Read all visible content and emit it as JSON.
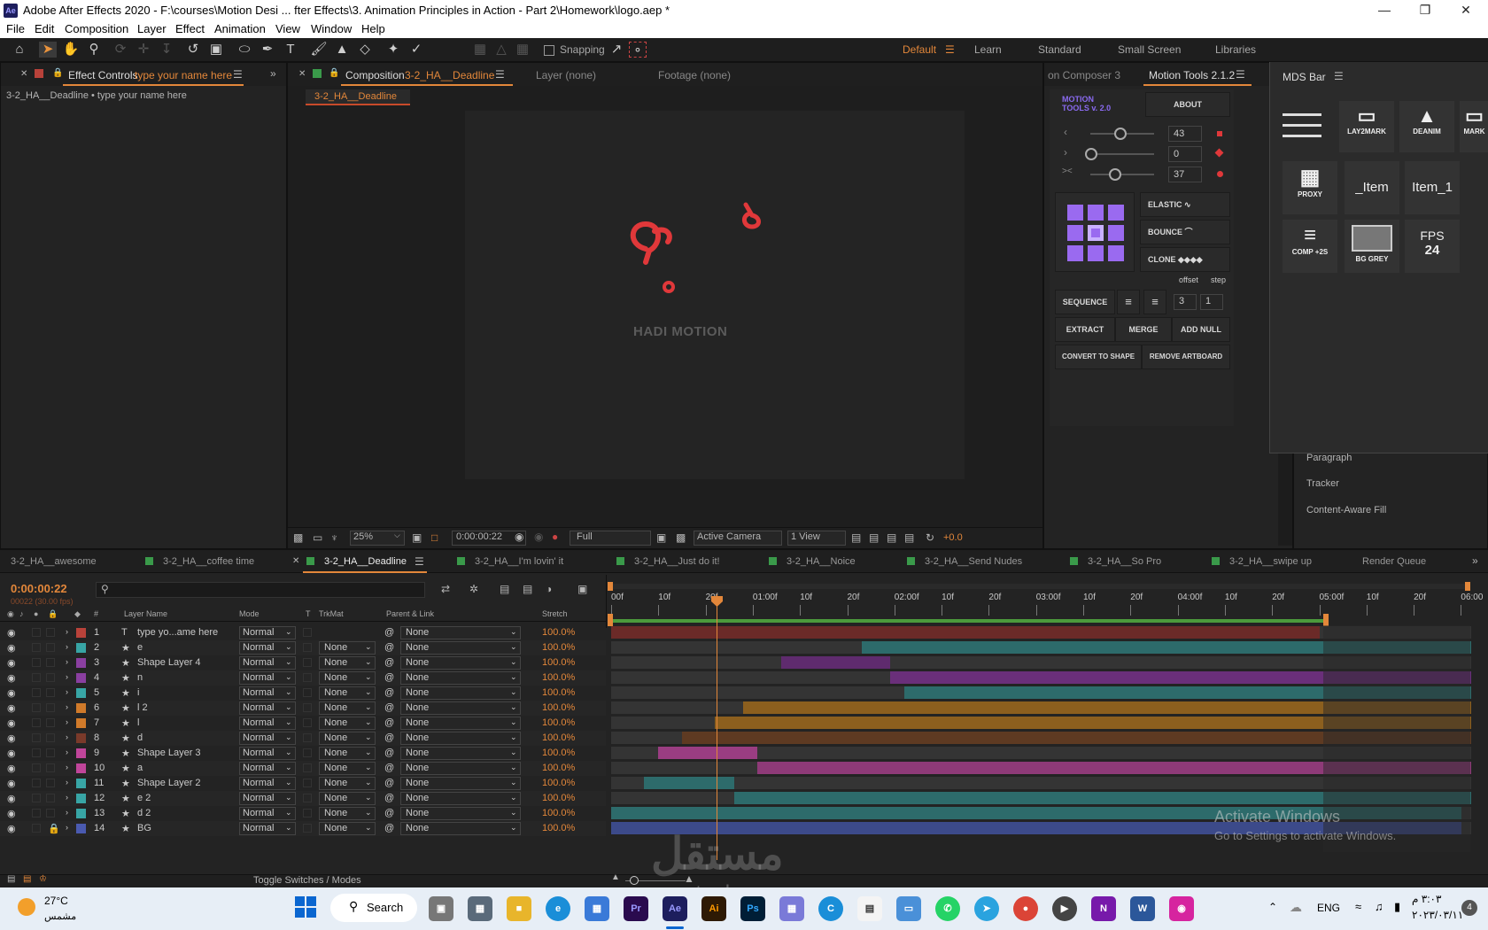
{
  "window": {
    "title": "Adobe After Effects 2020 - F:\\courses\\Motion Desi ... fter Effects\\3. Animation Principles in Action - Part 2\\Homework\\logo.aep *",
    "app_icon": "Ae"
  },
  "menu": [
    "File",
    "Edit",
    "Composition",
    "Layer",
    "Effect",
    "Animation",
    "View",
    "Window",
    "Help"
  ],
  "toolbar": {
    "snapping": "Snapping"
  },
  "workspaces": [
    "Default",
    "Learn",
    "Standard",
    "Small Screen",
    "Libraries"
  ],
  "effect_controls": {
    "tab": "Effect Controls",
    "tab_target": "type your name here",
    "subtitle": "3-2_HA__Deadline • type your name here"
  },
  "composition": {
    "tab": "Composition",
    "tab_name": "3-2_HA__Deadline",
    "layer_tab": "Layer (none)",
    "footage_tab": "Footage (none)",
    "subtab": "3-2_HA__Deadline",
    "watermark_text": "HADI MOTION"
  },
  "viewer_footer": {
    "zoom": "25%",
    "timecode": "0:00:00:22",
    "resolution": "Full",
    "camera": "Active Camera",
    "views": "1 View",
    "exposure": "+0.0"
  },
  "right_tabs": {
    "composer": "on Composer 3",
    "motion_tools": "Motion Tools 2.1.2",
    "mds": "MDS Bar"
  },
  "motion_tools": {
    "logo_line1": "MOTION",
    "logo_line2": "TOOLS v. 2.0",
    "about": "ABOUT",
    "slider_values": [
      "43",
      "0",
      "37"
    ],
    "elastic": "ELASTIC",
    "bounce": "BOUNCE",
    "clone": "CLONE",
    "offset_label": "offset",
    "step_label": "step",
    "sequence": "SEQUENCE",
    "offset_value": "3",
    "step_value": "1",
    "extract": "EXTRACT",
    "merge": "MERGE",
    "add_null": "ADD NULL",
    "convert": "CONVERT TO SHAPE",
    "remove_artboard": "REMOVE ARTBOARD"
  },
  "mds_bar": {
    "lay2mark": "LAY2MARK",
    "deanim": "DEANIM",
    "mark": "MARK",
    "proxy": "PROXY",
    "item": "_Item",
    "item1": "Item_1",
    "comp2s": "COMP +2S",
    "bggrey": "BG GREY",
    "fps_label": "FPS",
    "fps_value": "24"
  },
  "other_panels": [
    "Paragraph",
    "Tracker",
    "Content-Aware Fill"
  ],
  "timeline_tabs": [
    "3-2_HA__awesome",
    "3-2_HA__coffee time",
    "3-2_HA__Deadline",
    "3-2_HA__I'm lovin' it",
    "3-2_HA__Just do it!",
    "3-2_HA__Noice",
    "3-2_HA__Send Nudes",
    "3-2_HA__So Pro",
    "3-2_HA__swipe up",
    "Render Queue"
  ],
  "timeline": {
    "timecode": "0:00:00:22",
    "frames": "00022 (30.00 fps)",
    "columns": {
      "num": "#",
      "name": "Layer Name",
      "mode": "Mode",
      "t": "T",
      "trkmat": "TrkMat",
      "parent": "Parent & Link",
      "stretch": "Stretch"
    },
    "ruler": [
      "00f",
      "10f",
      "20f",
      "01:00f",
      "10f",
      "20f",
      "02:00f",
      "10f",
      "20f",
      "03:00f",
      "10f",
      "20f",
      "04:00f",
      "10f",
      "20f",
      "05:00f",
      "10f",
      "20f",
      "06:00"
    ],
    "toggle": "Toggle Switches / Modes",
    "layers": [
      {
        "num": "1",
        "name": "type yo...ame here",
        "mode": "Normal",
        "trkmat": "",
        "parent": "None",
        "stretch": "100.0%",
        "color": "#b8423a",
        "type": "T",
        "start": 0.0,
        "end": 5.0,
        "bar": "#6b2a28"
      },
      {
        "num": "2",
        "name": "e",
        "mode": "Normal",
        "trkmat": "None",
        "parent": "None",
        "stretch": "100.0%",
        "color": "#38a5a5",
        "type": "star",
        "start": 1.77,
        "end": 6.07,
        "bar": "#2d6b6b"
      },
      {
        "num": "3",
        "name": "Shape Layer 4",
        "mode": "Normal",
        "trkmat": "None",
        "parent": "None",
        "stretch": "100.0%",
        "color": "#8a3fa0",
        "type": "star",
        "start": 1.2,
        "end": 1.97,
        "bar": "#5f2b6e"
      },
      {
        "num": "4",
        "name": "n",
        "mode": "Normal",
        "trkmat": "None",
        "parent": "None",
        "stretch": "100.0%",
        "color": "#8a3fa0",
        "type": "star",
        "start": 1.97,
        "end": 6.07,
        "bar": "#6a2f7a"
      },
      {
        "num": "5",
        "name": "i",
        "mode": "Normal",
        "trkmat": "None",
        "parent": "None",
        "stretch": "100.0%",
        "color": "#38a5a5",
        "type": "star",
        "start": 2.07,
        "end": 6.07,
        "bar": "#2d6b6b"
      },
      {
        "num": "6",
        "name": "l 2",
        "mode": "Normal",
        "trkmat": "None",
        "parent": "None",
        "stretch": "100.0%",
        "color": "#d07a2a",
        "type": "star",
        "start": 0.93,
        "end": 6.07,
        "bar": "#8c5f1e"
      },
      {
        "num": "7",
        "name": "l",
        "mode": "Normal",
        "trkmat": "None",
        "parent": "None",
        "stretch": "100.0%",
        "color": "#d07a2a",
        "type": "star",
        "start": 0.73,
        "end": 6.07,
        "bar": "#8c5f1e"
      },
      {
        "num": "8",
        "name": "d",
        "mode": "Normal",
        "trkmat": "None",
        "parent": "None",
        "stretch": "100.0%",
        "color": "#7a3a2a",
        "type": "star",
        "start": 0.5,
        "end": 6.07,
        "bar": "#5e3a22"
      },
      {
        "num": "9",
        "name": "Shape Layer 3",
        "mode": "Normal",
        "trkmat": "None",
        "parent": "None",
        "stretch": "100.0%",
        "color": "#c0459a",
        "type": "star",
        "start": 0.33,
        "end": 1.03,
        "bar": "#9a3d82"
      },
      {
        "num": "10",
        "name": "a",
        "mode": "Normal",
        "trkmat": "None",
        "parent": "None",
        "stretch": "100.0%",
        "color": "#c0459a",
        "type": "star",
        "start": 1.03,
        "end": 6.07,
        "bar": "#8e3a78"
      },
      {
        "num": "11",
        "name": "Shape Layer 2",
        "mode": "Normal",
        "trkmat": "None",
        "parent": "None",
        "stretch": "100.0%",
        "color": "#38a5a5",
        "type": "star",
        "start": 0.23,
        "end": 0.87,
        "bar": "#2d6b6b"
      },
      {
        "num": "12",
        "name": "e 2",
        "mode": "Normal",
        "trkmat": "None",
        "parent": "None",
        "stretch": "100.0%",
        "color": "#38a5a5",
        "type": "star",
        "start": 0.87,
        "end": 6.07,
        "bar": "#2d6b6b"
      },
      {
        "num": "13",
        "name": "d 2",
        "mode": "Normal",
        "trkmat": "None",
        "parent": "None",
        "stretch": "100.0%",
        "color": "#38a5a5",
        "type": "star",
        "start": 0.0,
        "end": 6.0,
        "bar": "#2d6b6b"
      },
      {
        "num": "14",
        "name": "BG",
        "mode": "Normal",
        "trkmat": "None",
        "parent": "None",
        "stretch": "100.0%",
        "color": "#4a5ab0",
        "type": "star",
        "start": 0.0,
        "end": 6.0,
        "bar": "#3c4a8a"
      }
    ]
  },
  "activate": {
    "line1": "Activate Windows",
    "line2": "Go to Settings to activate Windows."
  },
  "watermark": {
    "arabic": "مستقل",
    "latin": "mostaql.com"
  },
  "taskbar": {
    "temp": "27°C",
    "weather": "مشمس",
    "search": "Search",
    "lang": "ENG",
    "time": "٣:٠٣ م",
    "date": "٢٠٢٣/٠٣/١١",
    "badge": "4"
  }
}
